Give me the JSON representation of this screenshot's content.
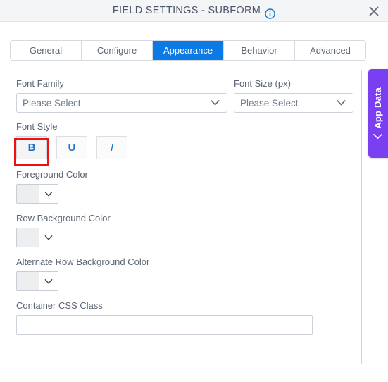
{
  "window": {
    "title": "FIELD SETTINGS - SUBFORM",
    "info_icon": "info-circle-icon",
    "close_icon": "close-icon"
  },
  "tabs": [
    {
      "label": "General",
      "active": false
    },
    {
      "label": "Configure",
      "active": false
    },
    {
      "label": "Appearance",
      "active": true
    },
    {
      "label": "Behavior",
      "active": false
    },
    {
      "label": "Advanced",
      "active": false
    }
  ],
  "form": {
    "font_family": {
      "label": "Font Family",
      "value": "Please Select",
      "placeholder": "Please Select"
    },
    "font_size": {
      "label": "Font Size (px)",
      "value": "Please Select",
      "placeholder": "Please Select"
    },
    "font_style": {
      "label": "Font Style",
      "buttons": [
        {
          "label": "B",
          "name": "bold-button",
          "selected": true
        },
        {
          "label": "U",
          "name": "underline-button",
          "selected": false
        },
        {
          "label": "I",
          "name": "italic-button",
          "selected": false
        }
      ]
    },
    "foreground_color": {
      "label": "Foreground Color",
      "swatch": "#eceef0"
    },
    "row_background_color": {
      "label": "Row Background Color",
      "swatch": "#eceef0"
    },
    "alternate_row_background_color": {
      "label": "Alternate Row Background Color",
      "swatch": "#eceef0"
    },
    "container_css_class": {
      "label": "Container CSS Class",
      "value": "",
      "placeholder": ""
    }
  },
  "side_panel": {
    "label": "App Data",
    "chevron_icon": "chevron-left-icon",
    "color": "#7b3ff2"
  },
  "colors": {
    "accent": "#0c7ae5",
    "highlight": "#ee1111",
    "title_text": "#4b5569",
    "label_text": "#5b6475"
  }
}
